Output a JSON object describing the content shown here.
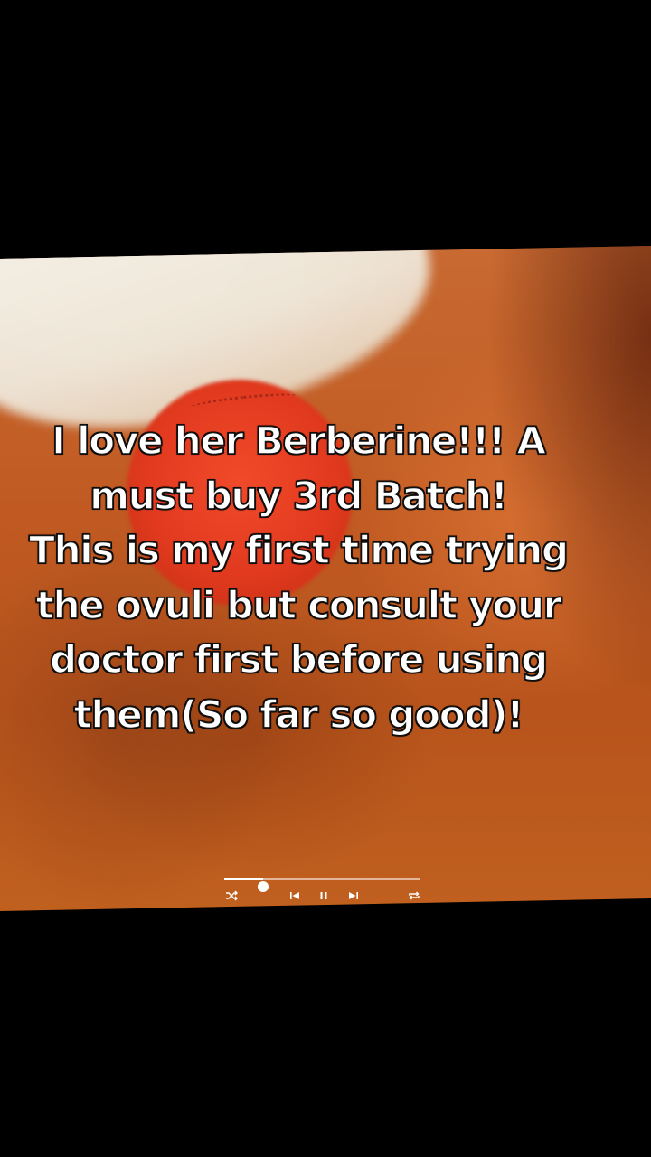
{
  "caption": {
    "lines": [
      "I love her Berberine!!! A",
      "must buy 3rd Batch!",
      "This is my first time trying",
      "the ovuli but consult your",
      "doctor first before using",
      "them(So far so good)!"
    ]
  },
  "player": {
    "progress_fraction": 0.2,
    "icons": {
      "shuffle": "shuffle-icon",
      "previous": "previous-icon",
      "pause": "pause-icon",
      "next": "next-icon",
      "repeat": "repeat-icon"
    }
  },
  "colors": {
    "background": "#000000",
    "caption_text": "#ffffff",
    "caption_outline": "#111111",
    "frame_orange": "#c05a22",
    "lid_red": "#e23a1f"
  }
}
